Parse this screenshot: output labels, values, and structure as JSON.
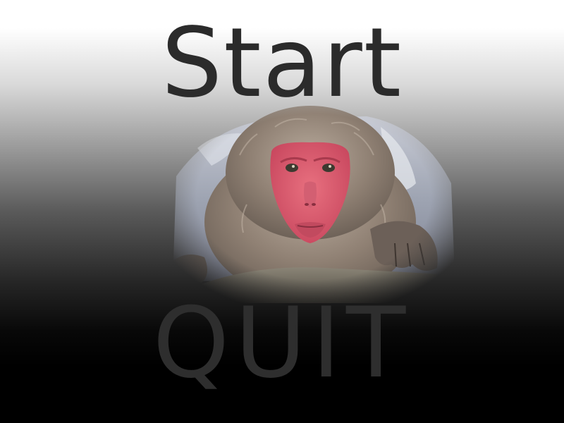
{
  "menu": {
    "start_label": "Start",
    "quit_label": "QUIT"
  },
  "colors": {
    "button_text": "#2b2b2b",
    "monkey_face": "#d9536a",
    "monkey_fur": "#9b8c80"
  },
  "image": {
    "icon": "snow-monkey-photo"
  }
}
